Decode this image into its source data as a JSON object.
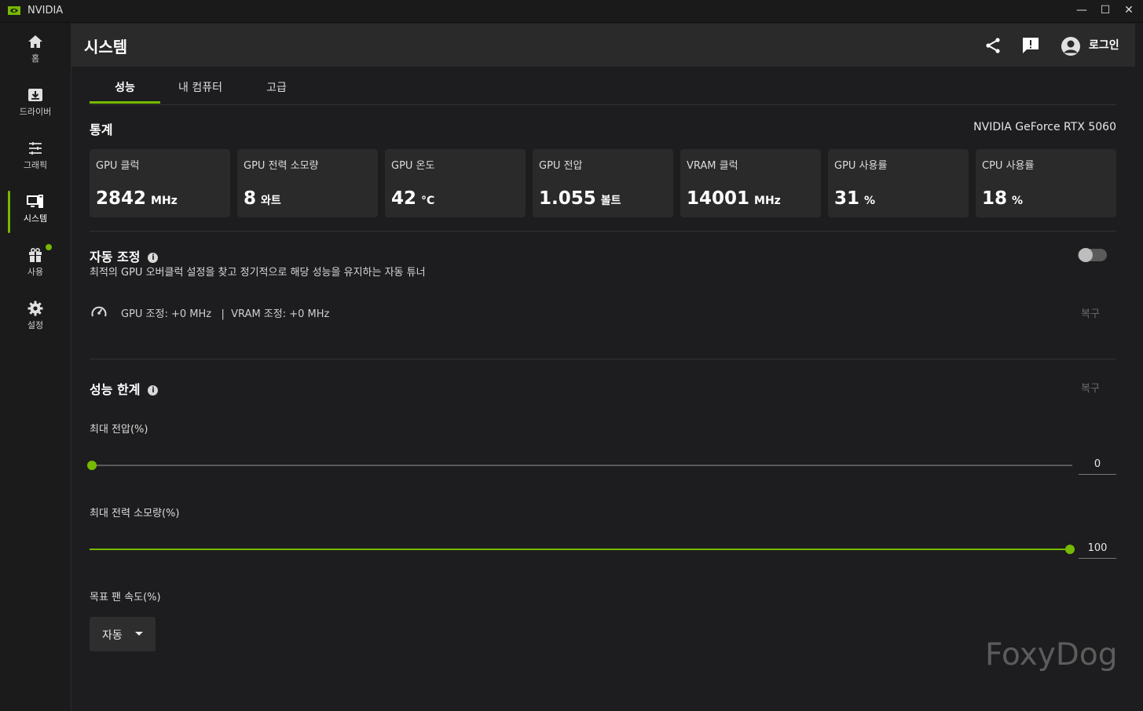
{
  "window": {
    "app_name": "NVIDIA",
    "minimize": "—",
    "maximize": "☐",
    "close": "✕"
  },
  "sidebar": {
    "items": [
      {
        "label": "홈",
        "icon": "home-icon"
      },
      {
        "label": "드라이버",
        "icon": "download-icon"
      },
      {
        "label": "그래픽",
        "icon": "sliders-icon"
      },
      {
        "label": "시스템",
        "icon": "system-icon",
        "active": true
      },
      {
        "label": "사용",
        "icon": "gift-icon",
        "badge": true
      },
      {
        "label": "설정",
        "icon": "gear-icon"
      }
    ]
  },
  "header": {
    "title": "시스템",
    "login": "로그인"
  },
  "tabs": [
    "성능",
    "내 컴퓨터",
    "고급"
  ],
  "stats": {
    "title": "통계",
    "gpu_name": "NVIDIA GeForce RTX 5060",
    "cards": [
      {
        "label": "GPU 클럭",
        "value": "2842",
        "unit": "MHz"
      },
      {
        "label": "GPU 전력 소모량",
        "value": "8",
        "unit": "와트"
      },
      {
        "label": "GPU 온도",
        "value": "42",
        "unit": "°C"
      },
      {
        "label": "GPU 전압",
        "value": "1.055",
        "unit": "볼트"
      },
      {
        "label": "VRAM 클럭",
        "value": "14001",
        "unit": "MHz"
      },
      {
        "label": "GPU 사용률",
        "value": "31",
        "unit": "%"
      },
      {
        "label": "CPU 사용률",
        "value": "18",
        "unit": "%"
      }
    ]
  },
  "auto_tune": {
    "title": "자동 조정",
    "info": "i",
    "description": "최적의 GPU 오버클럭 설정을 찾고 정기적으로 해당 성능을 유지하는 자동 튜너",
    "enabled": false,
    "tune_info": "GPU 조정: +0 MHz   |  VRAM 조정: +0 MHz",
    "reset": "복구"
  },
  "perf_limits": {
    "title": "성능 한계",
    "info": "i",
    "reset": "복구",
    "max_voltage": {
      "label": "최대 전압(%)",
      "value": "0",
      "fraction": 0
    },
    "max_power": {
      "label": "최대 전력 소모량(%)",
      "value": "100",
      "fraction": 1
    },
    "fan_speed": {
      "label": "목표 팬 속도(%)",
      "selected": "자동"
    }
  },
  "watermark": "FoxyDog",
  "colors": {
    "accent": "#76b900",
    "background": "#1d1d1f",
    "card": "#2a2a2b"
  }
}
